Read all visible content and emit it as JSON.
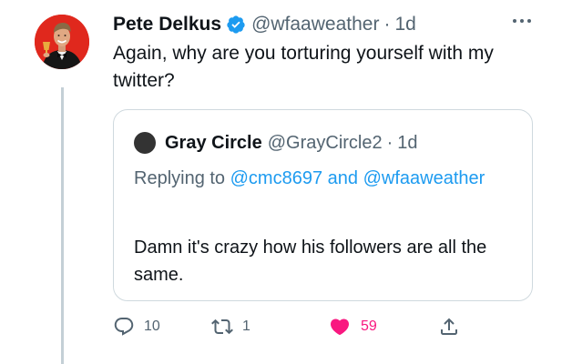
{
  "tweet": {
    "author": {
      "display_name": "Pete Delkus",
      "verified": true,
      "handle": "@wfaaweather",
      "separator": "·",
      "time": "1d"
    },
    "text": "Again, why are you torturing yourself with my twitter?",
    "quoted_tweet": {
      "author": {
        "display_name": "Gray Circle",
        "handle": "@GrayCircle2",
        "separator": "·",
        "time": "1d"
      },
      "replying_prefix": "Replying to",
      "replying_to_1": "@cmc8697",
      "replying_conjunction": "and",
      "replying_to_2": "@wfaaweather",
      "text": "Damn it's crazy how his followers are all the same."
    },
    "actions": {
      "reply_count": "10",
      "retweet_count": "1",
      "like_count": "59",
      "liked": true
    }
  },
  "icons": {
    "verified": "verified-badge-icon",
    "more": "more-dots-icon",
    "reply": "reply-bubble-icon",
    "retweet": "retweet-arrows-icon",
    "like": "heart-icon",
    "share": "share-arrow-icon"
  },
  "colors": {
    "verified_blue": "#1d9bf0",
    "mention_blue": "#1d9bf0",
    "like_pink": "#f91880",
    "secondary_text": "#536471",
    "primary_text": "#0f1419",
    "avatar_background": "#e0281d"
  }
}
